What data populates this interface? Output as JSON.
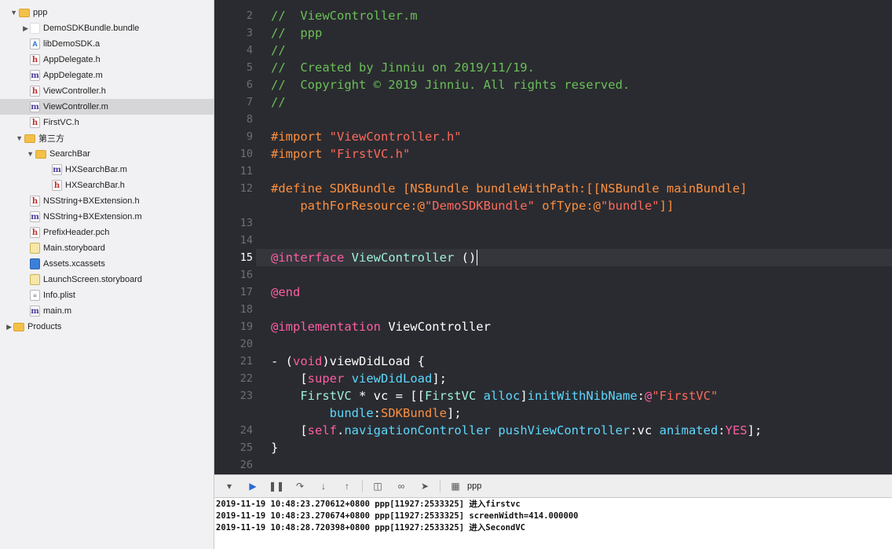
{
  "navigator": {
    "items": [
      {
        "label": "ppp",
        "icon": "folder-icon",
        "kind": "folder",
        "disclosure": "open",
        "indent": 0
      },
      {
        "label": "DemoSDKBundle.bundle",
        "icon": "bundle-icon",
        "kind": "bundle",
        "disclosure": "closed",
        "indent": 1
      },
      {
        "label": "libDemoSDK.a",
        "icon": "library-icon",
        "kind": "lib",
        "disclosure": "",
        "indent": 1
      },
      {
        "label": "AppDelegate.h",
        "icon": "header-file-icon",
        "kind": "h",
        "disclosure": "",
        "indent": 1
      },
      {
        "label": "AppDelegate.m",
        "icon": "objc-file-icon",
        "kind": "m",
        "disclosure": "",
        "indent": 1
      },
      {
        "label": "ViewController.h",
        "icon": "header-file-icon",
        "kind": "h",
        "disclosure": "",
        "indent": 1
      },
      {
        "label": "ViewController.m",
        "icon": "objc-file-icon",
        "kind": "m",
        "disclosure": "",
        "indent": 1,
        "selected": true
      },
      {
        "label": "FirstVC.h",
        "icon": "header-file-icon",
        "kind": "h",
        "disclosure": "",
        "indent": 1
      },
      {
        "label": "第三方",
        "icon": "folder-icon",
        "kind": "folder",
        "disclosure": "open",
        "indent": 0.5
      },
      {
        "label": "SearchBar",
        "icon": "folder-icon",
        "kind": "folder",
        "disclosure": "open",
        "indent": 1.5
      },
      {
        "label": "HXSearchBar.m",
        "icon": "objc-file-icon",
        "kind": "m",
        "disclosure": "",
        "indent": 3
      },
      {
        "label": "HXSearchBar.h",
        "icon": "header-file-icon",
        "kind": "h",
        "disclosure": "",
        "indent": 3
      },
      {
        "label": "NSString+BXExtension.h",
        "icon": "header-file-icon",
        "kind": "h",
        "disclosure": "",
        "indent": 1
      },
      {
        "label": "NSString+BXExtension.m",
        "icon": "objc-file-icon",
        "kind": "m",
        "disclosure": "",
        "indent": 1
      },
      {
        "label": "PrefixHeader.pch",
        "icon": "pch-file-icon",
        "kind": "pch",
        "disclosure": "",
        "indent": 1
      },
      {
        "label": "Main.storyboard",
        "icon": "storyboard-icon",
        "kind": "storyboard",
        "disclosure": "",
        "indent": 1
      },
      {
        "label": "Assets.xcassets",
        "icon": "assets-icon",
        "kind": "assets",
        "disclosure": "",
        "indent": 1
      },
      {
        "label": "LaunchScreen.storyboard",
        "icon": "storyboard-icon",
        "kind": "storyboard",
        "disclosure": "",
        "indent": 1
      },
      {
        "label": "Info.plist",
        "icon": "plist-icon",
        "kind": "plist",
        "disclosure": "",
        "indent": 1
      },
      {
        "label": "main.m",
        "icon": "objc-file-icon",
        "kind": "m",
        "disclosure": "",
        "indent": 1
      },
      {
        "label": "Products",
        "icon": "folder-icon",
        "kind": "folder",
        "disclosure": "closed",
        "indent": -0.5
      }
    ]
  },
  "editor": {
    "active_line": 15,
    "lines": [
      {
        "num": "2",
        "tokens": [
          [
            "c-comment",
            "//  ViewController.m"
          ]
        ]
      },
      {
        "num": "3",
        "tokens": [
          [
            "c-comment",
            "//  ppp"
          ]
        ]
      },
      {
        "num": "4",
        "tokens": [
          [
            "c-comment",
            "//"
          ]
        ]
      },
      {
        "num": "5",
        "tokens": [
          [
            "c-comment",
            "//  Created by Jinniu on 2019/11/19."
          ]
        ]
      },
      {
        "num": "6",
        "tokens": [
          [
            "c-comment",
            "//  Copyright © 2019 Jinniu. All rights reserved."
          ]
        ]
      },
      {
        "num": "7",
        "tokens": [
          [
            "c-comment",
            "//"
          ]
        ]
      },
      {
        "num": "8",
        "tokens": []
      },
      {
        "num": "9",
        "tokens": [
          [
            "c-pp",
            "#import "
          ],
          [
            "c-str",
            "\"ViewController.h\""
          ]
        ]
      },
      {
        "num": "10",
        "tokens": [
          [
            "c-pp",
            "#import "
          ],
          [
            "c-str",
            "\"FirstVC.h\""
          ]
        ]
      },
      {
        "num": "11",
        "tokens": []
      },
      {
        "num": "12",
        "tokens": [
          [
            "c-pp",
            "#define SDKBundle [NSBundle bundleWithPath:[[NSBundle mainBundle]"
          ]
        ]
      },
      {
        "num": "",
        "tokens": [
          [
            "c-pp",
            "    pathForResource:@"
          ],
          [
            "c-str",
            "\"DemoSDKBundle\""
          ],
          [
            "c-pp",
            " ofType:@"
          ],
          [
            "c-str",
            "\"bundle\""
          ],
          [
            "c-pp",
            "]]"
          ]
        ]
      },
      {
        "num": "13",
        "tokens": []
      },
      {
        "num": "14",
        "tokens": []
      },
      {
        "num": "15",
        "tokens": [
          [
            "c-kw",
            "@interface"
          ],
          [
            "",
            " "
          ],
          [
            "c-green",
            "ViewController"
          ],
          [
            "",
            " ()"
          ]
        ]
      },
      {
        "num": "16",
        "tokens": []
      },
      {
        "num": "17",
        "tokens": [
          [
            "c-kw",
            "@end"
          ]
        ]
      },
      {
        "num": "18",
        "tokens": []
      },
      {
        "num": "19",
        "tokens": [
          [
            "c-kw",
            "@implementation"
          ],
          [
            "",
            " ViewController"
          ]
        ]
      },
      {
        "num": "20",
        "tokens": []
      },
      {
        "num": "21",
        "tokens": [
          [
            "",
            "- ("
          ],
          [
            "c-kw",
            "void"
          ],
          [
            "",
            ")viewDidLoad {"
          ]
        ]
      },
      {
        "num": "22",
        "tokens": [
          [
            "",
            "    ["
          ],
          [
            "c-kw",
            "super"
          ],
          [
            "",
            " "
          ],
          [
            "c-cls",
            "viewDidLoad"
          ],
          [
            "",
            "];"
          ]
        ]
      },
      {
        "num": "23",
        "tokens": [
          [
            "",
            "    "
          ],
          [
            "c-green",
            "FirstVC"
          ],
          [
            "",
            " * vc = [["
          ],
          [
            "c-green",
            "FirstVC"
          ],
          [
            "",
            " "
          ],
          [
            "c-cls",
            "alloc"
          ],
          [
            "",
            "]"
          ],
          [
            "c-cls",
            "initWithNibName"
          ],
          [
            "",
            ":"
          ],
          [
            "c-kw",
            "@"
          ],
          [
            "c-str",
            "\"FirstVC\""
          ]
        ]
      },
      {
        "num": "",
        "tokens": [
          [
            "",
            "        "
          ],
          [
            "c-cls",
            "bundle"
          ],
          [
            "",
            ":"
          ],
          [
            "c-pp",
            "SDKBundle"
          ],
          [
            "",
            "];"
          ]
        ]
      },
      {
        "num": "24",
        "tokens": [
          [
            "",
            "    ["
          ],
          [
            "c-kw",
            "self"
          ],
          [
            "",
            "."
          ],
          [
            "c-cls",
            "navigationController"
          ],
          [
            "",
            " "
          ],
          [
            "c-cls",
            "pushViewController"
          ],
          [
            "",
            ":vc "
          ],
          [
            "c-cls",
            "animated"
          ],
          [
            "",
            ":"
          ],
          [
            "c-kw",
            "YES"
          ],
          [
            "",
            "];"
          ]
        ]
      },
      {
        "num": "25",
        "tokens": [
          [
            "",
            "}"
          ]
        ]
      },
      {
        "num": "26",
        "tokens": []
      }
    ]
  },
  "debug_bar": {
    "target": "ppp",
    "buttons": [
      "hide-console-icon",
      "breakpoints-icon",
      "pause-icon",
      "step-over-icon",
      "step-into-icon",
      "step-out-icon",
      "view-debugger-icon",
      "memory-graph-icon",
      "location-icon"
    ]
  },
  "console": {
    "lines": [
      "2019-11-19 10:48:23.270612+0800 ppp[11927:2533325] 进入firstvc",
      "2019-11-19 10:48:23.270674+0800 ppp[11927:2533325] screenWidth=414.000000",
      "2019-11-19 10:48:28.720398+0800 ppp[11927:2533325] 进入SecondVC"
    ]
  }
}
